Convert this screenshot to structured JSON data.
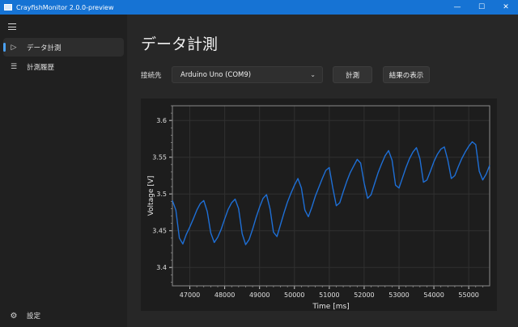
{
  "window": {
    "title": "CrayfishMonitor 2.0.0-preview",
    "minimize": "—",
    "maximize": "☐",
    "close": "✕"
  },
  "sidebar": {
    "menu_icon": "hamburger-icon",
    "items": [
      {
        "label": "データ計測",
        "icon": "▷",
        "selected": true
      },
      {
        "label": "計測履歴",
        "icon": "☰",
        "selected": false
      }
    ],
    "settings": {
      "label": "設定",
      "icon": "⚙"
    }
  },
  "main": {
    "title": "データ計測",
    "connection_label": "接続先",
    "connection_value": "Arduino Uno (COM9)",
    "measure_button": "計測",
    "results_button": "結果の表示"
  },
  "chart_data": {
    "type": "line",
    "xlabel": "Time [ms]",
    "ylabel": "Voltage [V]",
    "xlim": [
      46500,
      55600
    ],
    "ylim": [
      3.375,
      3.62
    ],
    "xticks": [
      "47000",
      "48000",
      "49000",
      "50000",
      "51000",
      "52000",
      "53000",
      "54000",
      "55000"
    ],
    "yticks": [
      "3.6",
      "3.55",
      "3.5",
      "3.45",
      "3.4"
    ],
    "grid": true,
    "color": "#1e6fd6",
    "series": [
      {
        "x": [
          46500,
          46600,
          46700,
          46800,
          46900,
          47000,
          47100,
          47200,
          47300,
          47400,
          47500,
          47600,
          47700,
          47800,
          47900,
          48000,
          48100,
          48200,
          48300,
          48400,
          48500,
          48600,
          48700,
          48800,
          48900,
          49000,
          49100,
          49200,
          49300,
          49400,
          49500,
          49600,
          49700,
          49800,
          49900,
          50000,
          50100,
          50200,
          50300,
          50400,
          50500,
          50600,
          50700,
          50800,
          50900,
          51000,
          51100,
          51200,
          51300,
          51400,
          51500,
          51600,
          51700,
          51800,
          51900,
          52000,
          52100,
          52200,
          52300,
          52400,
          52500,
          52600,
          52700,
          52800,
          52900,
          53000,
          53100,
          53200,
          53300,
          53400,
          53500,
          53600,
          53700,
          53800,
          53900,
          54000,
          54100,
          54200,
          54300,
          54400,
          54500,
          54600,
          54700,
          54800,
          54900,
          55000,
          55100,
          55200,
          55300,
          55400,
          55500,
          55600
        ],
        "y": [
          3.491,
          3.478,
          3.44,
          3.432,
          3.445,
          3.455,
          3.466,
          3.478,
          3.487,
          3.491,
          3.476,
          3.447,
          3.434,
          3.441,
          3.452,
          3.466,
          3.479,
          3.488,
          3.493,
          3.48,
          3.446,
          3.431,
          3.438,
          3.452,
          3.468,
          3.482,
          3.494,
          3.499,
          3.48,
          3.448,
          3.442,
          3.458,
          3.474,
          3.489,
          3.501,
          3.512,
          3.521,
          3.508,
          3.478,
          3.469,
          3.482,
          3.497,
          3.509,
          3.521,
          3.532,
          3.536,
          3.508,
          3.484,
          3.488,
          3.503,
          3.517,
          3.529,
          3.538,
          3.547,
          3.542,
          3.515,
          3.494,
          3.499,
          3.514,
          3.529,
          3.541,
          3.552,
          3.559,
          3.546,
          3.512,
          3.508,
          3.522,
          3.536,
          3.548,
          3.557,
          3.563,
          3.548,
          3.516,
          3.519,
          3.531,
          3.544,
          3.554,
          3.561,
          3.564,
          3.546,
          3.521,
          3.525,
          3.537,
          3.548,
          3.557,
          3.565,
          3.571,
          3.567,
          3.531,
          3.519,
          3.527,
          3.539
        ]
      }
    ]
  }
}
